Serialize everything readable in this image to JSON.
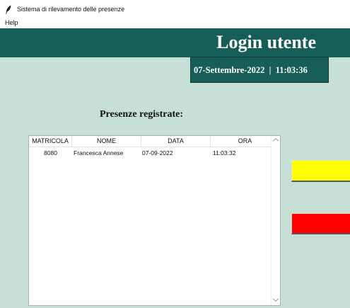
{
  "window": {
    "title": "Sistema di rilevamento delle presenze",
    "icon": "feather-icon"
  },
  "menu": {
    "help_label": "Help"
  },
  "header": {
    "title": "Login utente",
    "datetime": "07-Settembre-2022  |  11:03:36"
  },
  "attendance": {
    "title": "Presenze registrate:",
    "columns": [
      "MATRICOLA",
      "NOME",
      "DATA",
      "ORA"
    ],
    "rows": [
      [
        "8080",
        "Francesca Annese",
        "07-09-2022",
        "11:03:32"
      ]
    ]
  },
  "buttons": {
    "yellow_color": "#ffff00",
    "red_color": "#ff0000"
  },
  "colors": {
    "background": "#c6e0d6",
    "header": "#175e59"
  }
}
